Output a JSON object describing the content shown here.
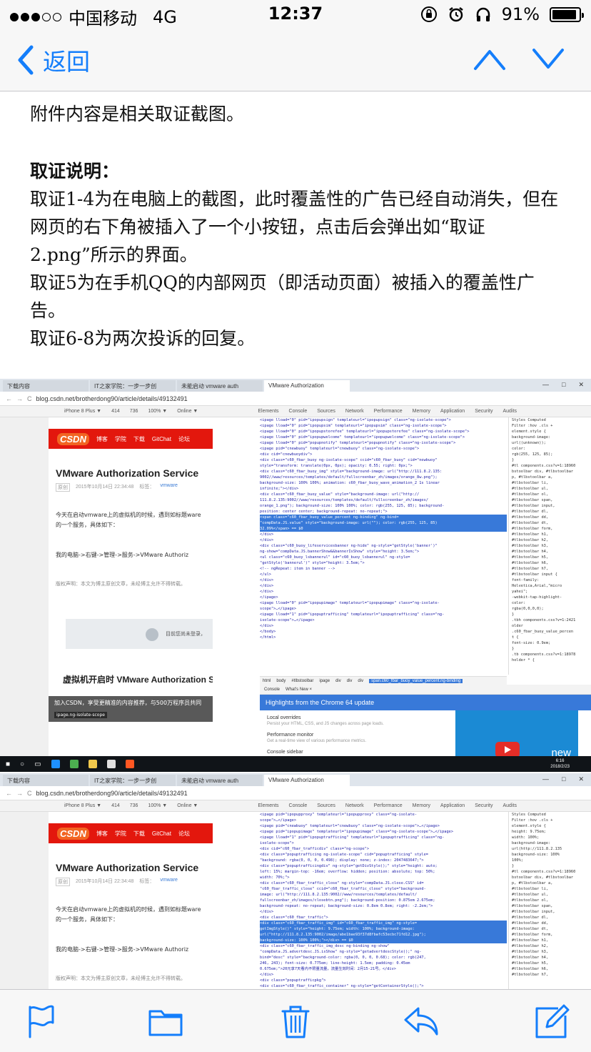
{
  "status_bar": {
    "carrier": "中国移动",
    "network": "4G",
    "time": "12:37",
    "battery": "91%",
    "battery_level": 0.91
  },
  "nav": {
    "back_label": "返回"
  },
  "email": {
    "intro": "附件内容是相关取证截图。",
    "heading": "取证说明：",
    "paragraph_1": "取证1-4为在电脑上的截图，此时覆盖性的广告已经自动消失，但在网页的右下角被插入了一个小按钮，点击后会弹出如“取证2.png”所示的界面。",
    "paragraph_2": "取证5为在手机QQ的内部网页（即活动页面）被插入的覆盖性广告。",
    "paragraph_3": "取证6-8为两次投诉的回复。"
  },
  "screenshot_1": {
    "tabs": [
      "下载内容",
      "IT之家学院：一步一步创",
      "未能启动 vmware auth",
      "VMware Authorization"
    ],
    "url": "blog.csdn.net/brotherdong90/article/details/49132491",
    "device_toolbar": [
      "iPhone 8 Plus ▼",
      "414",
      "×",
      "736",
      "100% ▼",
      "Online ▼"
    ],
    "devtools_tabs": [
      "Elements",
      "Console",
      "Sources",
      "Network",
      "Performance",
      "Memory",
      "Application",
      "Security",
      "Audits"
    ],
    "csdn_nav": [
      "博客",
      "学院",
      "下载",
      "GitChat",
      "论坛"
    ],
    "article_title": "VMware Authorization Service",
    "article_tag": "原创",
    "article_date": "2015年10月14日 22:34:48",
    "article_label": "标签：",
    "article_label_link": "vmware",
    "article_text": "今天在启动vmware上的虚拟机的时候，遇到如标题ware的一个服务，具体如下：",
    "article_path": "我的电脑->右键->管理->服务->VMware Authoriz",
    "copyright": "版权声明：本文为博主原创文章，未经博主允许不得转载。",
    "login_prompt": "目前您尚未登录，",
    "second_title": "虚拟机开启时 VMware Authorization Se",
    "bubble_text": "加入CSDN，享受更精准的内容推荐，与500万程序员共同",
    "bubble_tag": "ipage.ng-isolate-scope",
    "code_lines": [
      "<ipage lload=\"0\" pid=\"ipopupsign\" templateurl=\"ipopupsign\" class=\"ng-isolate-scope\">",
      "<ipage lload=\"0\" pid=\"ipopupsim\" templateurl=\"ipopupsim\" class=\"ng-isolate-scope\">",
      "<ipage lload=\"0\" pid=\"ipopupstorefee\" templateurl=\"ipopupstorefee\" class=\"ng-isolate-scope\">",
      "<ipage lload=\"0\" pid=\"ipopupwelcome\" templateurl=\"ipopupwelcome\" class=\"ng-isolate-scope\">",
      "<ipage lload=\"0\" pid=\"popupnotify\" templateurl=\"popupnotify\" class=\"ng-isolate-scope\">",
      "<ipage pid=\"cnewbuoy\" templateurl=\"cnewbuoy\" class=\"ng-isolate-scope\">",
      "<div cid=\"cnewbuoydiv\">",
      "<div class=\"c60_fbar_buoy ng-isolate-scope\" ccid=\"c60_fbar_buoy\" cid=\"newbuoy\"",
      "style=\"transform: translate(0px, 0px); opacity: 0.55; right: 0px;\">",
      "<div class=\"c60_fbar_buoy_img\" style=\"background-image: url(\"http://111.8.2.135:",
      "9002//www/resources/templates/default/fullscreenbar_zh/images/orange_8w.png\");",
      "background-size: 100% 100%; animation: c60_fbar_buoy_wave_animation_2 1s linear",
      "infinite;\"></div>",
      "<div class=\"c60_fbar_buoy_value\" style=\"background-image: url(\"http://",
      "111.8.2.135:9002//www/resources/templates/default/fullscreenbar_zh/images/",
      "orange_1.png\"); background-size: 100% 100%; color: rgb(255, 125, 85); background-",
      "position: center center; background-repeat: no-repeat;\">",
      "<span class=\"c60_fbar_buoy_value_percent ng-binding\" ng-bind=",
      "\"compData.JS.value\" style=\"background-image: url(\"\"); color: rgb(255, 125, 85)",
      "32.09%</span> == $0",
      "</div>",
      "</div>",
      "<div class=\"c60_buoy_lifeservicesbanner ng-hide\" ng-style=\"getStyle('banner')\"",
      "ng-show=\"compData.JS.bannerShow&&bannerIsShow\" style=\"height: 3.5em;\">",
      "<ul class=\"c60_buoy_lsbannerul\" id=\"c60_buoy_lsbannerul\" ng-style=",
      "\"getStyle('bannerul')\" style=\"height: 3.5em;\">",
      "<!-- ngRepeat: item in banner -->",
      "</ul>",
      "</div>",
      "</div>",
      "</div>",
      "</ipage>",
      "<ipage lload=\"0\" pid=\"ipopupimage\" templateurl=\"ipopupimage\" class=\"ng-isolate-",
      "scope\">…</ipage>",
      "<ipage lload=\"1\" pid=\"ipopuptrafficing\" templateurl=\"ipopuptrafficing\" class=\"ng-",
      "isolate-scope\">…</ipage>",
      "</div>",
      "</body>",
      "</html>"
    ],
    "highlight_rows": [
      17,
      18,
      19
    ],
    "styles_lines": [
      "Styles  Computed",
      "Filter              :hov  .cls  +",
      "element.style {",
      "  background-image:",
      "    url((unknown));",
      "  color:",
      "    rgb(255, 125, 85);",
      "}",
      "#tl components.css?v=1:18960",
      "bstoolbar div, #tlbstoolbar",
      "p, #tlbstoolbar a,",
      "#tlbstoolbar li,",
      "#tlbstoolbar ul,",
      "#tlbstoolbar ol,",
      "#tlbstoolbar span,",
      "#tlbstoolbar input,",
      "#tlbstoolbar dl,",
      "#tlbstoolbar dd,",
      "#tlbstoolbar dt,",
      "#tlbstoolbar form,",
      "#tlbstoolbar h1,",
      "#tlbstoolbar h2,",
      "#tlbstoolbar h3,",
      "#tlbstoolbar h4,",
      "#tlbstoolbar h5,",
      "#tlbstoolbar h6,",
      "#tlbstoolbar h7,",
      "#tlbstoolbar input {",
      "  font-family:",
      "    Helvetica,Arial,\"micro",
      "    yahei\";",
      "  -webkit-tap-highlight-",
      "    color:",
      "    rgba(0,0,0,0);",
      "}",
      ".tbh components.css?v=1:2421",
      "older",
      ".c60_fbar_buoy_value_percen",
      "t {",
      "  font-size: 0.9em;",
      "}",
      ".tb components.css?v=1:18978",
      "holder * {"
    ],
    "breadcrumb": [
      "html",
      "body",
      "#tlbstoolbar",
      "ipage",
      "div",
      "div",
      "div"
    ],
    "breadcrumb_selected": "span.c60_fbar_buoy_value_percent.ng-binding",
    "drawer_tabs": [
      "Console",
      "What's New ×"
    ],
    "drawer_title": "Highlights from the Chrome 64 update",
    "drawer_items": [
      {
        "title": "Local overrides",
        "sub": "Persist your HTML, CSS, and JS changes across page loads."
      },
      {
        "title": "Performance monitor",
        "sub": "Get a real-time view of various performance metrics."
      },
      {
        "title": "Console sidebar",
        "sub": ""
      }
    ],
    "promo_text": "new",
    "clock_time": "6:16",
    "clock_date": "2018/2/23"
  },
  "screenshot_2": {
    "tabs": [
      "下载内容",
      "IT之家学院：一步一步创",
      "未能启动 vmware auth",
      "VMware Authorization"
    ],
    "url": "blog.csdn.net/brotherdong90/article/details/49132491",
    "device_toolbar": [
      "iPhone 8 Plus ▼",
      "414",
      "×",
      "736",
      "100% ▼",
      "Online ▼"
    ],
    "devtools_tabs": [
      "Elements",
      "Console",
      "Sources",
      "Network",
      "Performance",
      "Memory",
      "Application",
      "Security",
      "Audits"
    ],
    "csdn_nav": [
      "博客",
      "学院",
      "下载",
      "GitChat",
      "论坛"
    ],
    "article_title": "VMware Authorization Service",
    "article_tag": "原创",
    "article_date": "2015年10月14日 22:34:48",
    "article_label": "标签：",
    "article_label_link": "vmware",
    "article_text": "今天在启动vmware上的虚拟机的时候，遇到如标题ware的一个服务，具体如下：",
    "article_path": "我的电脑->右键->管理->服务->VMware Authoriz",
    "copyright": "版权声明：本文为博主原创文章，未经博主允许不得转载。",
    "code_lines": [
      "<ipage pid=\"ipopupproxy\" templateurl=\"ipopupproxy\" class=\"ng-isolate-",
      "scope\">…</ipage>",
      "<ipage pid=\"cnewbuoy\" templateurl=\"cnewbuoy\" class=\"ng-isolate-scope\">…</ipage>",
      "<ipage pid=\"ipopupimage\" templateurl=\"ipopupimage\" class=\"ng-isolate-scope\">…</ipage>",
      "<ipage lload=\"1\" pid=\"ipopuptrafficing\" templateurl=\"ipopuptrafficing\" class=\"ng-",
      "isolate-scope\">",
      "<div cid=\"c60_fbar_trafficdiv\" class=\"ng-scope\">",
      "<div class=\"popuptrafficing ng-isolate-scope\" cid=\"popuptrafficing\" style=",
      "\"background: rgba(0, 0, 0, 0.498); display: none; z-index: 2047483647;\">",
      "<div class=\"popuptrafficingdiv\" ng-style=\"getDivStyle();\" style=\"height: auto;",
      "left: 15%; margin-top: -16em; overflow: hidden; position: absolute; top: 50%;",
      "width: 70%;\">",
      "<div class=\"c60_fbar_traffic_close\" ng-style=\"compData.JS.close.CSS\" id=",
      "\"c60_fbar_traffic_close\" ccid=\"c60_fbar_traffic_close\" style=\"background-",
      "image: url(\"http://111.8.2.135:9002//www/resources/templates/default/",
      "fullscreenbar_zh/images/closebtn.png\"); background-position: 0.875em 2.675em;",
      "background-repeat: no-repeat; background-size: 0.8em 0.8em; right: -2.2em;\">",
      "</div>",
      "<div class=\"c60_fbar_traffic\">",
      "<div class=\"c60_fbar_traffic_img\" id=\"c60_fbar_traffic_img\" ng-style=",
      "getImgStyle()\" style=\"height: 9.75em; width: 100%; background-image:",
      "url(\"http://111.8.2.135:9002/image/abe1bae93f37d8fbafc53ecbc71fd12.jpg\");",
      "background-size: 100% 100%;\"></div> == $0",
      "<div class=\"c60_fbar_traffic_img_desc ng-binding ng-show\"",
      "\"compData.JS.advertdesc.JS.isShow\" ng-style=\"getadvertdescStyle();\" ng-",
      "bind=\"desc\" style=\"background-color: rgba(0, 0, 0, 0.68); color: rgb(247,",
      "246, 243); font-size: 0.775em; line-height: 1.5em; padding: 0.45em",
      "0.675em;\">20元享7天看内不限量流量，流量生效时间：2月15-21号。</div>",
      "</div>",
      "<div class=\"popuptrafficpkg\">",
      "<div class=\"c60_fbar_traffic_container\" ng-style=\"getContainerStyle();\">"
    ],
    "highlight_rows": [
      19,
      20,
      21,
      22
    ],
    "styles_lines": [
      "Styles  Computed",
      "Filter              :hov  .cls  +",
      "element.style {",
      "  height: 9.75em;",
      "  width: 100%;",
      "  background-image:",
      "    url(http://111.8.2.135",
      "  background-size: 100%",
      "    100%;",
      "}",
      "#tl components.css?v=1:18960",
      "bstoolbar div, #tlbstoolbar",
      "p, #tlbstoolbar a,",
      "#tlbstoolbar li,",
      "#tlbstoolbar ul,",
      "#tlbstoolbar ol,",
      "#tlbstoolbar span,",
      "#tlbstoolbar input,",
      "#tlbstoolbar dl,",
      "#tlbstoolbar dd,",
      "#tlbstoolbar dt,",
      "#tlbstoolbar form,",
      "#tlbstoolbar h1,",
      "#tlbstoolbar h2,",
      "#tlbstoolbar h3,",
      "#tlbstoolbar h4,",
      "#tlbstoolbar h5,",
      "#tlbstoolbar h6,",
      "#tlbstoolbar h7,"
    ]
  },
  "toolbar": {
    "icons": [
      "flag-icon",
      "folder-icon",
      "trash-icon",
      "reply-icon",
      "compose-icon"
    ]
  },
  "colors": {
    "ios_blue": "#147efb",
    "csdn_red": "#e3170d",
    "devtools_highlight": "#3879d9"
  }
}
